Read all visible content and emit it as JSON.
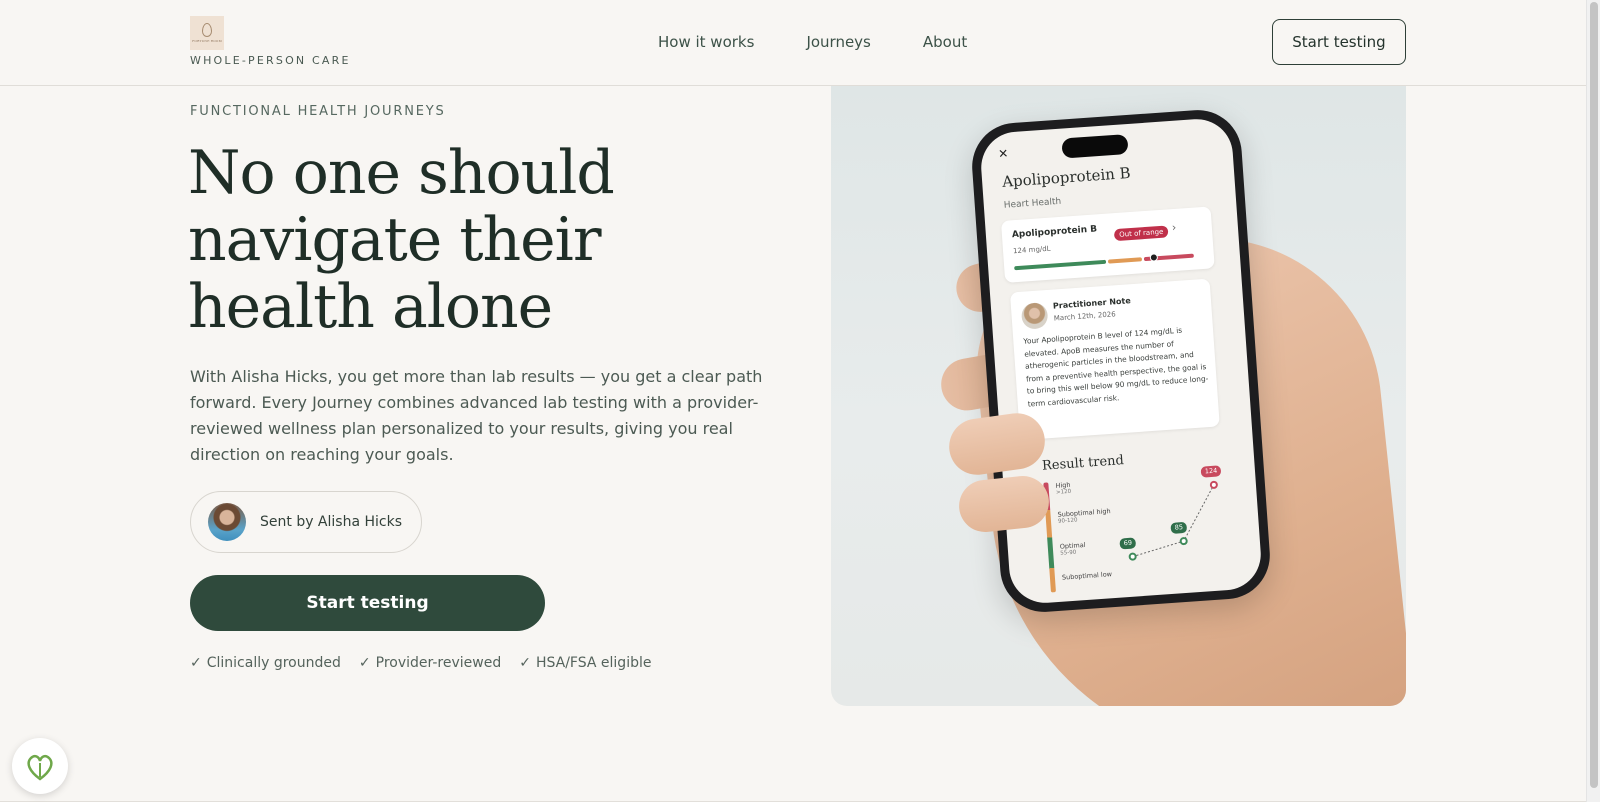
{
  "brand": {
    "logo_text": "FORTUNE ROOM",
    "tagline": "WHOLE-PERSON CARE"
  },
  "nav": {
    "items": [
      "How it works",
      "Journeys",
      "About"
    ],
    "cta": "Start testing"
  },
  "hero": {
    "eyebrow": "FUNCTIONAL HEALTH JOURNEYS",
    "headline": "No one should navigate their health alone",
    "lead": "With Alisha Hicks, you get more than lab results — you get a clear path forward. Every Journey combines advanced lab testing with a provider-reviewed wellness plan personalized to your results, giving you real direction on reaching your goals.",
    "sender": "Sent by Alisha Hicks",
    "cta": "Start testing",
    "checks": [
      "Clinically grounded",
      "Provider-reviewed",
      "HSA/FSA eligible"
    ]
  },
  "phone": {
    "title": "Apolipoprotein B",
    "subtitle": "Heart Health",
    "marker": {
      "name": "Apolipoprotein B",
      "value": "124 mg/dL",
      "badge": "Out of range"
    },
    "note": {
      "title": "Practitioner Note",
      "date": "March 12th, 2026",
      "body": "Your Apolipoprotein B level of 124 mg/dL is elevated. ApoB measures the number of atherogenic particles in the bloodstream, and from a preventive health perspective, the goal is to bring this well below 90 mg/dL to reduce long-term cardiovascular risk."
    },
    "trend": {
      "title": "Result trend",
      "zones": [
        {
          "label": "High",
          "range": ">120"
        },
        {
          "label": "Suboptimal high",
          "range": "90-120"
        },
        {
          "label": "Optimal",
          "range": "55-90"
        },
        {
          "label": "Suboptimal low",
          "range": ""
        }
      ],
      "points": [
        "69",
        "85",
        "124"
      ]
    }
  },
  "colors": {
    "primary": "#2f4a3c",
    "background": "#f8f6f3",
    "alert": "#c0304a"
  }
}
